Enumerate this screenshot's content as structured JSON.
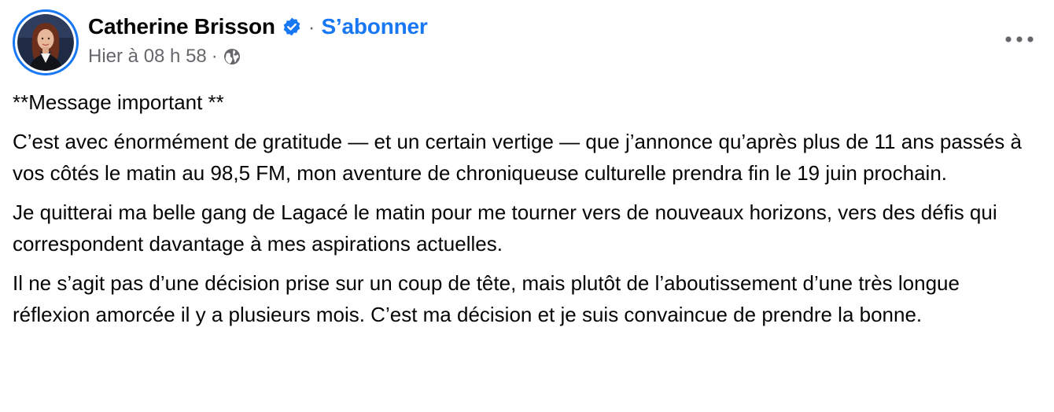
{
  "author": {
    "name": "Catherine Brisson",
    "follow_label": "S’abonner",
    "separator": "·",
    "timestamp": "Hier à 08 h 58",
    "audience_icon": "globe-icon",
    "verified_icon": "verified-badge-icon"
  },
  "menu": {
    "icon": "more-options-icon"
  },
  "post": {
    "paragraphs": [
      "**Message important **",
      "C’est avec énormément de gratitude — et un certain vertige — que j’annonce qu’après plus de 11 ans passés à vos côtés le matin au 98,5 FM, mon aventure de chroniqueuse culturelle prendra fin le 19 juin prochain.",
      "Je quitterai ma belle gang de Lagacé le matin pour me tourner vers de nouveaux horizons, vers des défis qui correspondent davantage à mes aspirations actuelles.",
      "Il ne s’agit pas d’une décision prise sur un coup de tête, mais plutôt de l’aboutissement d’une très longue réflexion amorcée il y a plusieurs mois. C’est ma décision et je suis convaincue de prendre la bonne."
    ]
  },
  "colors": {
    "accent": "#1877f2",
    "secondary_text": "#65676b",
    "primary_text": "#050505"
  }
}
